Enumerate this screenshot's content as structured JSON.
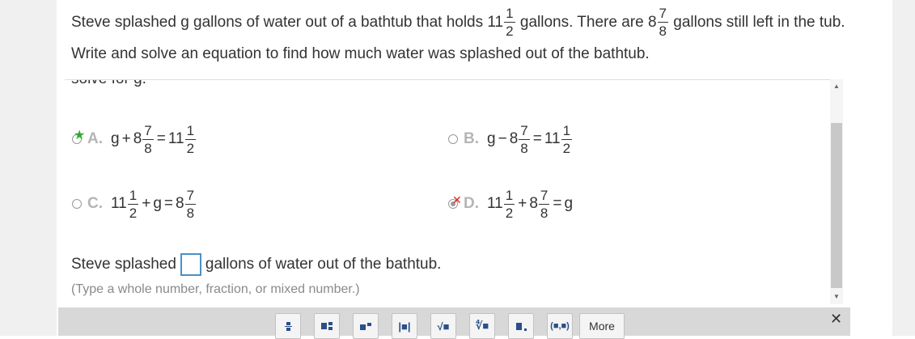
{
  "question": {
    "part1": "Steve splashed g gallons of water out of a bathtub that holds 11",
    "tub_frac": {
      "num": "1",
      "den": "2"
    },
    "part2": " gallons. There are 8",
    "left_frac": {
      "num": "7",
      "den": "8"
    },
    "part3": " gallons still left in the tub. Write and solve an equation to find how much water was splashed out of the bathtub."
  },
  "cut_off_text": "solve for g.",
  "options": {
    "a": {
      "letter": "A.",
      "var": "g",
      "op1": "+",
      "whole1": "8",
      "frac1": {
        "num": "7",
        "den": "8"
      },
      "eq": "=",
      "whole2": "11",
      "frac2": {
        "num": "1",
        "den": "2"
      }
    },
    "b": {
      "letter": "B.",
      "var": "g",
      "op1": "−",
      "whole1": "8",
      "frac1": {
        "num": "7",
        "den": "8"
      },
      "eq": "=",
      "whole2": "11",
      "frac2": {
        "num": "1",
        "den": "2"
      }
    },
    "c": {
      "letter": "C.",
      "whole1": "11",
      "frac1": {
        "num": "1",
        "den": "2"
      },
      "op1": "+",
      "var": "g",
      "eq": "=",
      "whole2": "8",
      "frac2": {
        "num": "7",
        "den": "8"
      }
    },
    "d": {
      "letter": "D.",
      "whole1": "11",
      "frac1": {
        "num": "1",
        "den": "2"
      },
      "op1": "+",
      "whole2": "8",
      "frac2": {
        "num": "7",
        "den": "8"
      },
      "eq": "=",
      "var": "g"
    }
  },
  "marks": {
    "correct_symbol": "★",
    "wrong_symbol": "✕"
  },
  "answer_line": {
    "before": "Steve splashed",
    "after": "gallons of water out of the bathtub."
  },
  "hint": "(Type a whole number, fraction, or mixed number.)",
  "scrollbar": {
    "up": "▲",
    "down": "▼"
  },
  "toolbar": {
    "more_label": "More",
    "vector_label": "(■,■)",
    "abs_label": "|■|",
    "sqrt_label": "√■",
    "nroot_label": "∜■",
    "close_symbol": "✕",
    "buttons": [
      "fraction-icon",
      "mixed-number-icon",
      "exponent-icon",
      "absolute-value-icon",
      "square-root-icon",
      "nth-root-icon",
      "decimal-icon",
      "ordered-pair-icon"
    ]
  },
  "colors": {
    "correct": "#2eab2e",
    "wrong": "#e02020",
    "answer_box_border": "#4a90c6",
    "letter": "#b5b5b5"
  }
}
